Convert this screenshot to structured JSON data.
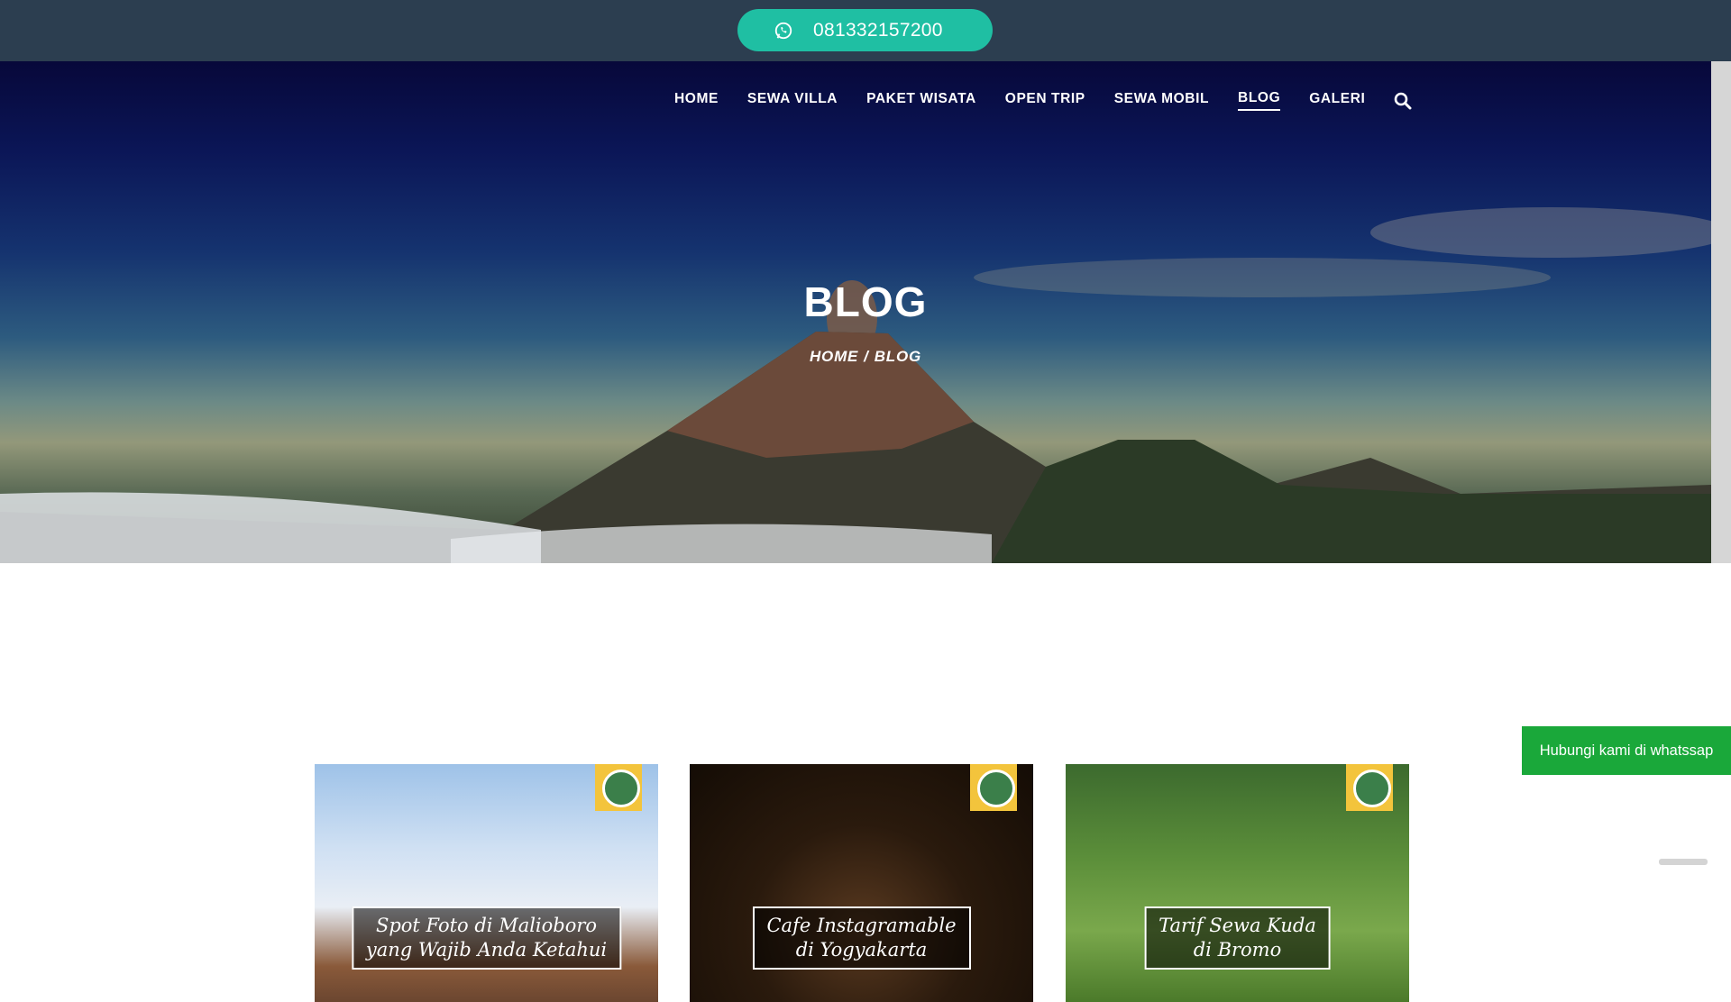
{
  "topbar": {
    "phone": "081332157200",
    "icon": "whatsapp-icon",
    "pill_color": "#1fbfa3",
    "bar_color": "#2c3e50"
  },
  "nav": {
    "items": [
      {
        "label": "HOME"
      },
      {
        "label": "SEWA VILLA"
      },
      {
        "label": "PAKET WISATA"
      },
      {
        "label": "OPEN TRIP"
      },
      {
        "label": "SEWA MOBIL"
      },
      {
        "label": "BLOG",
        "active": true
      },
      {
        "label": "GALERI"
      }
    ],
    "search_icon": "search-icon"
  },
  "hero": {
    "title": "BLOG",
    "breadcrumb": {
      "home": "HOME",
      "separator": "/",
      "current": "BLOG"
    }
  },
  "float": {
    "whatsapp_label": "Hubungi kami di whatssap",
    "color": "#1aa83a"
  },
  "cards": [
    {
      "caption_line1": "Spot Foto di Malioboro",
      "caption_line2": "yang Wajib Anda Ketahui"
    },
    {
      "caption_line1": "Cafe Instagramable",
      "caption_line2": "di Yogyakarta"
    },
    {
      "caption_line1": "Tarif Sewa Kuda",
      "caption_line2": "di Bromo"
    }
  ]
}
